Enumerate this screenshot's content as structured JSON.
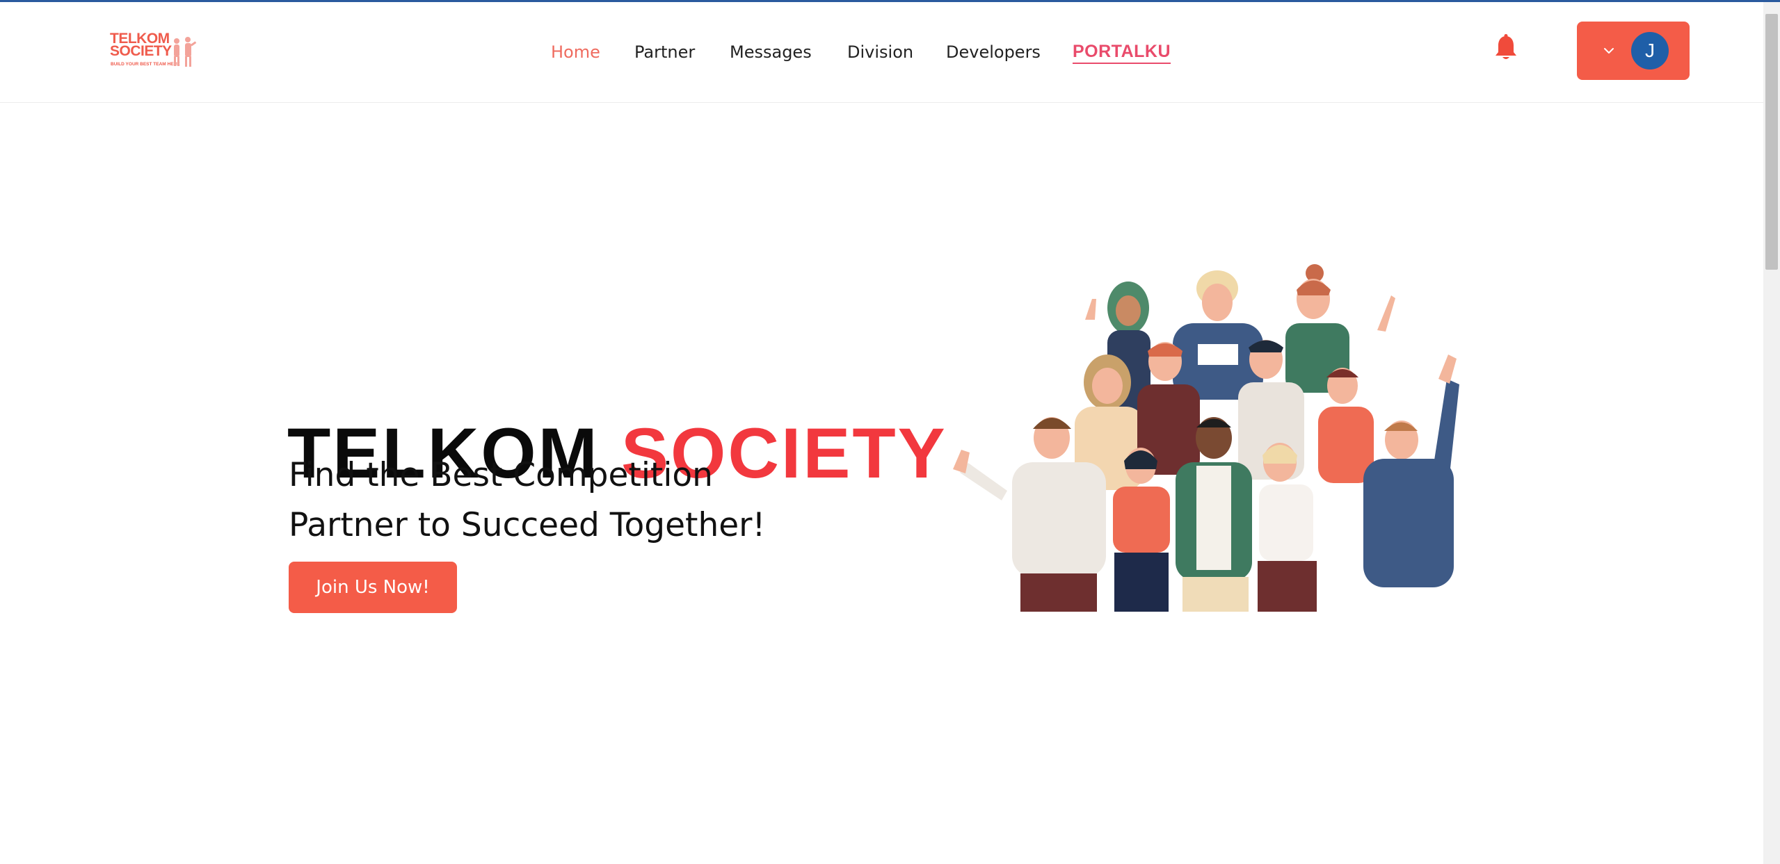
{
  "brand": {
    "logo_line1": "TELKOM",
    "logo_line2": "SOCIETY",
    "logo_tagline": "BUILD YOUR BEST TEAM HERE",
    "accent_color": "#f45c48",
    "title_red": "#f2383e"
  },
  "nav": {
    "items": [
      {
        "label": "Home",
        "active": true
      },
      {
        "label": "Partner",
        "active": false
      },
      {
        "label": "Messages",
        "active": false
      },
      {
        "label": "Division",
        "active": false
      },
      {
        "label": "Developers",
        "active": false
      }
    ],
    "portal_label": "PORTALKU"
  },
  "header": {
    "notification_icon": "bell-icon",
    "user_initial": "J",
    "dropdown_icon": "chevron-down-icon"
  },
  "hero": {
    "title_part1": "TELKOM",
    "title_part2": "SOCIETY",
    "subtitle_line1": "Find the Best Competition",
    "subtitle_line2": "Partner to Succeed Together!",
    "cta_label": "Join Us Now!",
    "illustration": "group-of-people-illustration"
  }
}
